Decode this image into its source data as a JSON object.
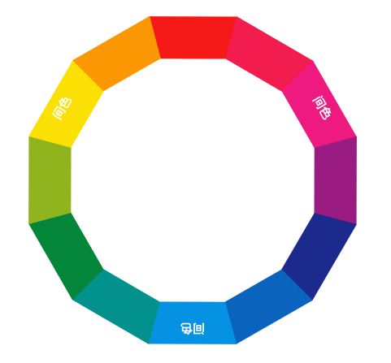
{
  "color_wheel": {
    "segments": [
      {
        "name": "red",
        "color": "#f41816"
      },
      {
        "name": "red-magenta",
        "color": "#f31c4f"
      },
      {
        "name": "magenta",
        "color": "#ee1a80"
      },
      {
        "name": "purple",
        "color": "#9a1c82"
      },
      {
        "name": "indigo",
        "color": "#1c2a8e"
      },
      {
        "name": "blue",
        "color": "#0a64bd"
      },
      {
        "name": "azure",
        "color": "#0692e2"
      },
      {
        "name": "teal",
        "color": "#03918e"
      },
      {
        "name": "green",
        "color": "#04863a"
      },
      {
        "name": "yellow-green",
        "color": "#90b41d"
      },
      {
        "name": "yellow",
        "color": "#fbe004"
      },
      {
        "name": "orange",
        "color": "#fb9703"
      }
    ],
    "labels": [
      {
        "text": "间色"
      },
      {
        "text": "间色"
      },
      {
        "text": "间色"
      }
    ]
  }
}
